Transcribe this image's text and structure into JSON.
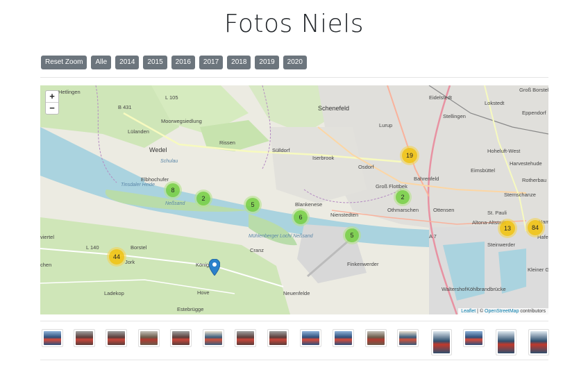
{
  "page": {
    "title": "Fotos Niels"
  },
  "filters": [
    {
      "label": "Reset Zoom"
    },
    {
      "label": "Alle"
    },
    {
      "label": "2014"
    },
    {
      "label": "2015"
    },
    {
      "label": "2016"
    },
    {
      "label": "2017"
    },
    {
      "label": "2018"
    },
    {
      "label": "2019"
    },
    {
      "label": "2020"
    }
  ],
  "map": {
    "zoom_in": "+",
    "zoom_out": "−",
    "attribution_leaflet": "Leaflet",
    "attribution_sep": " | © ",
    "attribution_osm": "OpenStreetMap",
    "attribution_suffix": " contributors",
    "clusters": [
      {
        "count": "8",
        "color": "green"
      },
      {
        "count": "2",
        "color": "green"
      },
      {
        "count": "5",
        "color": "green"
      },
      {
        "count": "6",
        "color": "green"
      },
      {
        "count": "5",
        "color": "green"
      },
      {
        "count": "2",
        "color": "green"
      },
      {
        "count": "19",
        "color": "yellow"
      },
      {
        "count": "13",
        "color": "yellow"
      },
      {
        "count": "84",
        "color": "yellow"
      },
      {
        "count": "44",
        "color": "yellow"
      }
    ],
    "places": [
      "Hetlingen",
      "L 105",
      "Eidelstedt",
      "Lokstedt",
      "Groß Borstel",
      "B 431",
      "Schenefeld",
      "Stellingen",
      "Lurup",
      "Moorwegsiedlung",
      "Lülanden",
      "Rissen",
      "Sülldorf",
      "Iserbrook",
      "Wedel",
      "Schulau",
      "Osdorf",
      "Eppendorf",
      "Hoheluft-West",
      "Harvestehude",
      "Eimsbüttel",
      "Bahrenfeld",
      "Rotherbau",
      "Sternschanze",
      "Elbhochufer",
      "Groß Flottbek",
      "Blankenese",
      "Othmarschen",
      "Ottensen",
      "St. Pauli",
      "Nienstedten",
      "Altona-Altstadt",
      "Steinwerder",
      "Hafen",
      "Ham",
      "A 7",
      "viertel",
      "L 140",
      "Borstel",
      "Jork",
      "chen",
      "Cranz",
      "Finkenwerder",
      "Kleiner G",
      "Ladekop",
      "Königreich",
      "Hove",
      "Neuenfelde",
      "Waltershof",
      "Köhlbrandbrücke",
      "Estebrügge",
      "Neßsand",
      "Mühlenberger Loch/ Neßsand",
      "Tinsdaler Heide",
      "Schulau"
    ]
  },
  "thumbnails": [
    {
      "variant": "a"
    },
    {
      "variant": "b"
    },
    {
      "variant": "b"
    },
    {
      "variant": "c"
    },
    {
      "variant": "b"
    },
    {
      "variant": "d"
    },
    {
      "variant": "b"
    },
    {
      "variant": "b"
    },
    {
      "variant": "a"
    },
    {
      "variant": "a"
    },
    {
      "variant": "c"
    },
    {
      "variant": "d"
    },
    {
      "variant": "e"
    },
    {
      "variant": "a"
    },
    {
      "variant": "e"
    },
    {
      "variant": "e"
    }
  ],
  "colors": {
    "button_bg": "#6c757d",
    "cluster_small": "#6ecc39",
    "cluster_medium": "#f0c20c",
    "marker": "#2a81cb",
    "water": "#aad3df"
  }
}
